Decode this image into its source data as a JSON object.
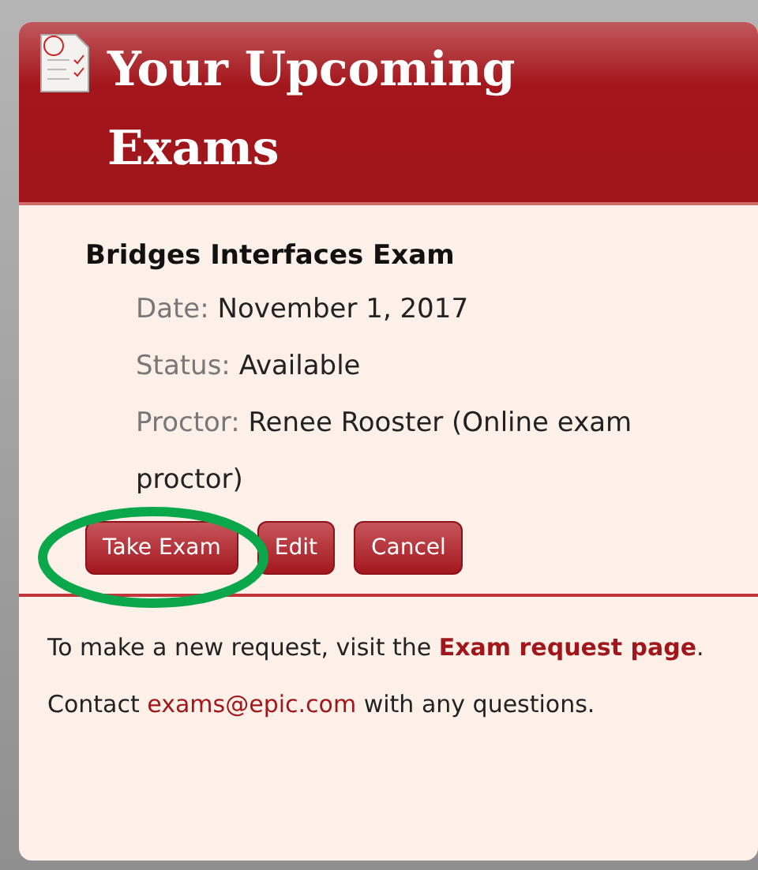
{
  "panel": {
    "title": "Your Upcoming Exams"
  },
  "exam": {
    "name": "Bridges Interfaces Exam",
    "fields": [
      {
        "label": "Date:",
        "value": "November 1, 2017"
      },
      {
        "label": "Status:",
        "value": "Available"
      },
      {
        "label": "Proctor:",
        "value": "Renee Rooster (Online exam proctor)"
      }
    ],
    "buttons": [
      {
        "label": "Take Exam",
        "highlighted": true
      },
      {
        "label": "Edit",
        "highlighted": false
      },
      {
        "label": "Cancel",
        "highlighted": false
      }
    ]
  },
  "footer": {
    "text_before": "To make a new request, visit the",
    "link": "Exam request page",
    "text_middle": ". Contact",
    "email": "exams@epic.com",
    "text_after": "with any questions."
  }
}
